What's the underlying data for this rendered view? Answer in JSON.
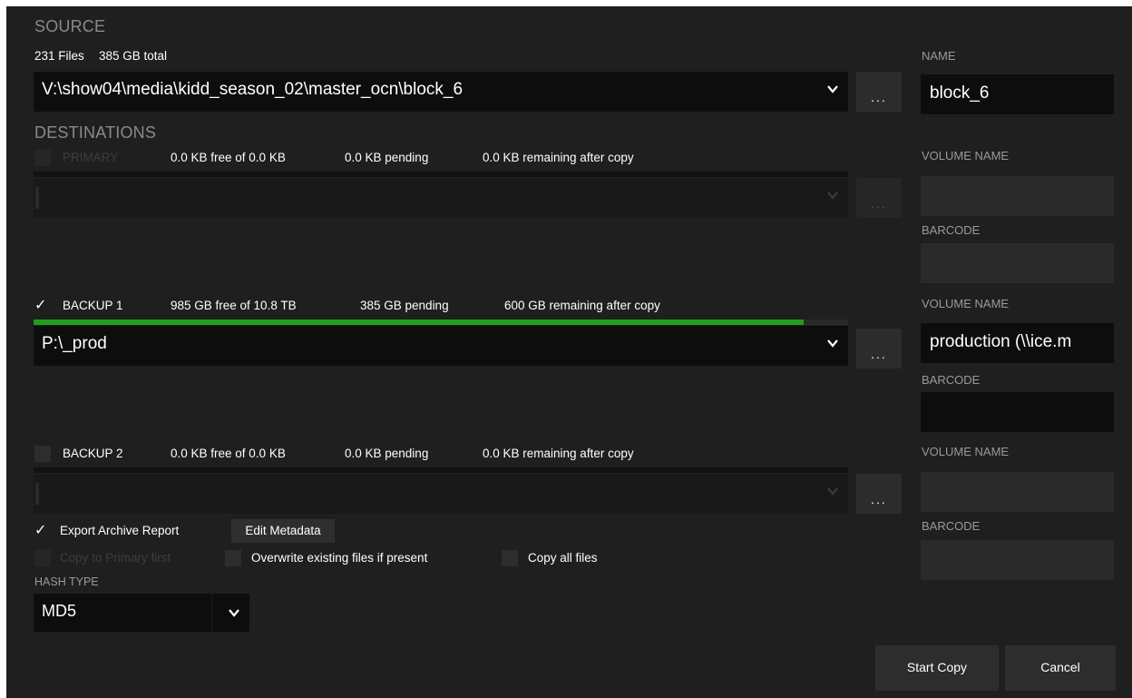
{
  "source": {
    "title": "SOURCE",
    "file_count": "231 Files",
    "total_size": "385 GB total",
    "path": "V:\\show04\\media\\kidd_season_02\\master_ocn\\block_6",
    "browse_label": "...",
    "name_label": "NAME",
    "name_value": "block_6"
  },
  "destinations": {
    "title": "DESTINATIONS",
    "primary": {
      "label": "PRIMARY",
      "checked": false,
      "free": "0.0 KB free of 0.0 KB",
      "pending": "0.0 KB pending",
      "remaining": "0.0 KB remaining after copy",
      "path": "",
      "browse_label": "...",
      "volume_name_label": "VOLUME NAME",
      "volume_name": "",
      "barcode_label": "BARCODE",
      "barcode": "",
      "progress": 0
    },
    "backup1": {
      "label": "BACKUP 1",
      "checked": true,
      "check_glyph": "✓",
      "free": "985 GB free of 10.8 TB",
      "pending": "385 GB pending",
      "remaining": "600 GB remaining after copy",
      "path": "P:\\_prod",
      "browse_label": "...",
      "volume_name_label": "VOLUME NAME",
      "volume_name": "production (\\\\ice.m",
      "barcode_label": "BARCODE",
      "barcode": "",
      "progress": 0.945
    },
    "backup2": {
      "label": "BACKUP 2",
      "checked": false,
      "free": "0.0 KB free of 0.0 KB",
      "pending": "0.0 KB pending",
      "remaining": "0.0 KB remaining after copy",
      "path": "",
      "browse_label": "...",
      "volume_name_label": "VOLUME NAME",
      "volume_name": "",
      "barcode_label": "BARCODE",
      "barcode": ""
    }
  },
  "options": {
    "export_archive_report": {
      "label": "Export Archive Report",
      "checked": true,
      "check_glyph": "✓"
    },
    "edit_metadata_label": "Edit Metadata",
    "copy_to_primary_first": {
      "label": "Copy to Primary first",
      "checked": false,
      "disabled": true
    },
    "overwrite_existing": {
      "label": "Overwrite existing files if present",
      "checked": false
    },
    "copy_all_files": {
      "label": "Copy all files",
      "checked": false
    }
  },
  "hash": {
    "label": "HASH TYPE",
    "value": "MD5"
  },
  "actions": {
    "start_copy": "Start Copy",
    "cancel": "Cancel"
  },
  "icons": {
    "dropdown": "chevron-down-icon",
    "check": "checkmark-icon"
  },
  "colors": {
    "background": "#1f1f1f",
    "field": "#0d0d0d",
    "progress": "#1f9e1f",
    "label_gray": "#9a9a9a"
  }
}
